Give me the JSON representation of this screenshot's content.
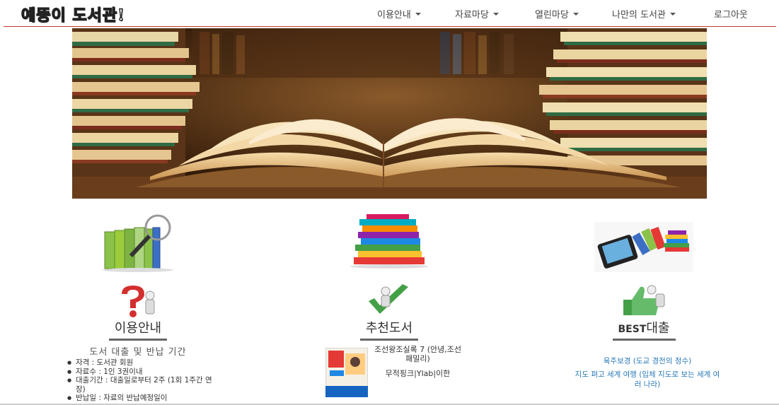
{
  "brand": {
    "title": "예뚱이 도서관!"
  },
  "nav": {
    "items": [
      {
        "label": "이용안내",
        "dropdown": true
      },
      {
        "label": "자료마당",
        "dropdown": true
      },
      {
        "label": "열린마당",
        "dropdown": true
      },
      {
        "label": "나만의 도서관",
        "dropdown": true
      },
      {
        "label": "로그아웃",
        "dropdown": false
      }
    ]
  },
  "columns": {
    "guide": {
      "title": "이용안내",
      "subtitle": "도서 대출 및 반납 기간",
      "items": [
        "자격 : 도서관 회원",
        "자료수 : 1인 3권이내",
        "대출기간 : 대출일로부터 2주 (1회 1주간 연장)",
        "반납일 : 자료의 반납예정일이"
      ]
    },
    "recommend": {
      "title": "추천도서",
      "book_title": "조선왕조실록 7 (안녕,조선 패밀리)",
      "book_author": "무적핑크|Ylab|이한"
    },
    "best": {
      "title_bold": "BEST",
      "title_rest": "대출",
      "links": [
        "육주보경 (도교 경전의 정수)",
        "지도 펴고 세계 여행 (입체 지도로 보는 세계 여러 나라)"
      ]
    }
  },
  "colors": {
    "accent_line": "#c0392b",
    "link": "#2a7ab8"
  }
}
